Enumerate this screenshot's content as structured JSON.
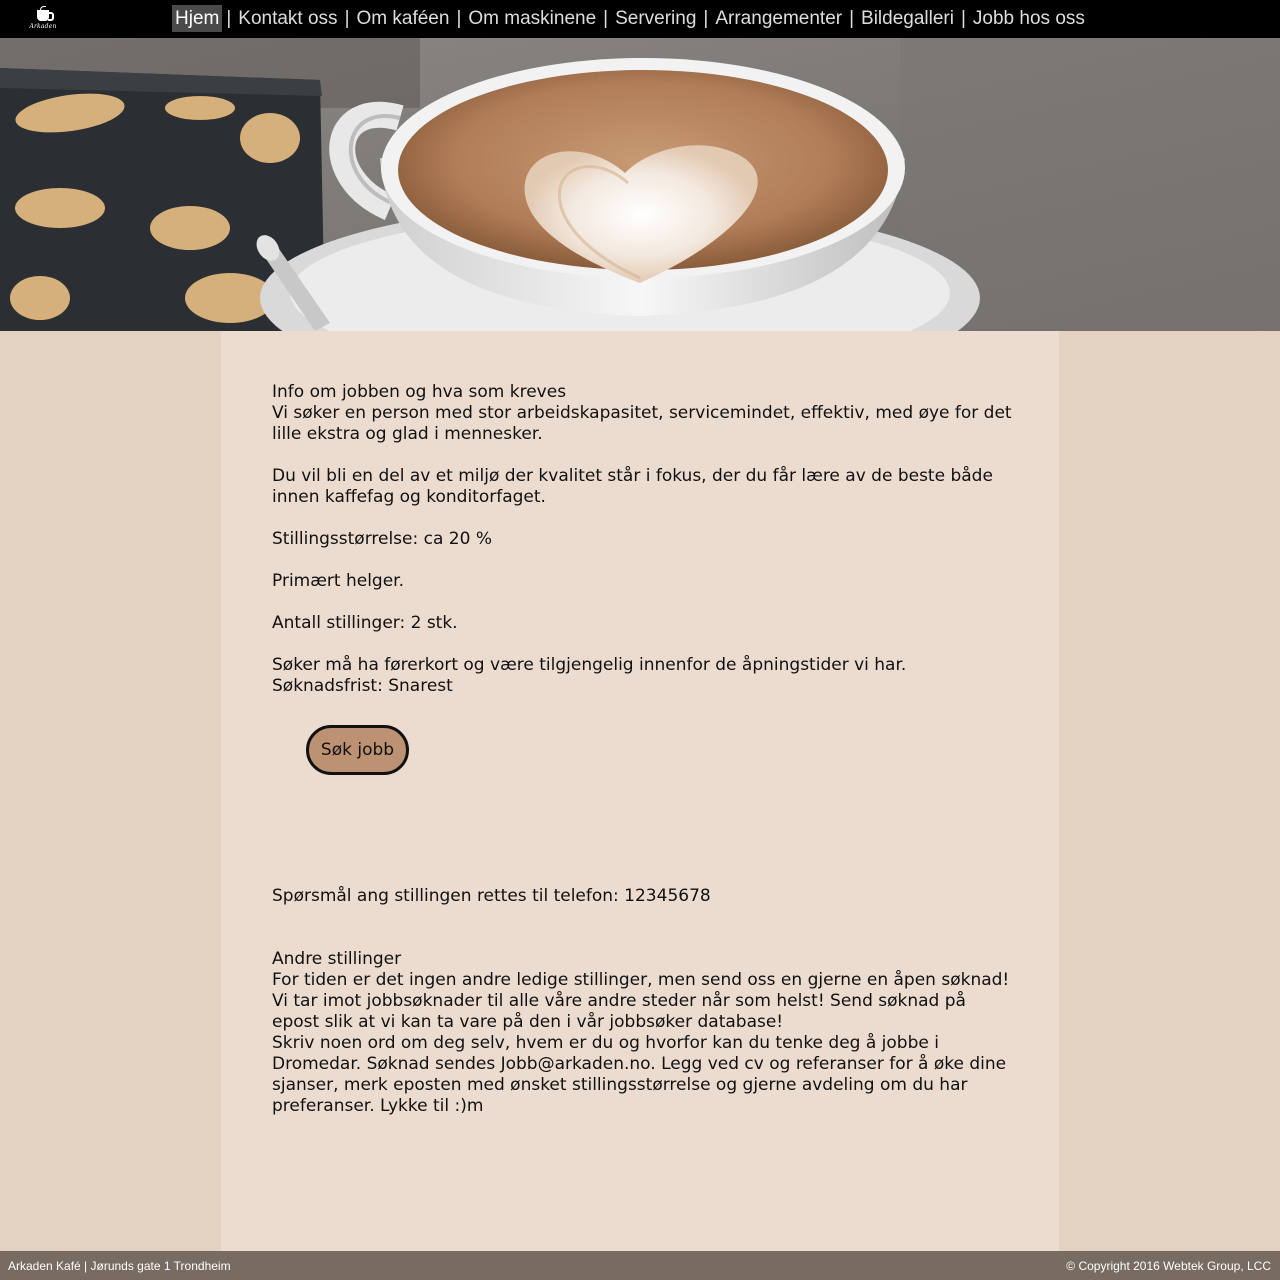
{
  "nav": {
    "logo_text": "Arkaden",
    "items": [
      {
        "label": "Hjem",
        "active": true
      },
      {
        "label": "Kontakt oss"
      },
      {
        "label": "Om kaféen"
      },
      {
        "label": "Om maskinene"
      },
      {
        "label": "Servering"
      },
      {
        "label": "Arrangementer"
      },
      {
        "label": "Bildegalleri"
      },
      {
        "label": "Jobb hos oss"
      }
    ],
    "separator": "|"
  },
  "content": {
    "job_heading": "Info om jobben og hva som kreves",
    "job_desc": "Vi søker en person med stor arbeidskapasitet, servicemindet, effektiv, med øye for det lille ekstra og glad i mennesker.",
    "environment": "Du vil bli en del av et miljø der kvalitet står i fokus, der du får lære av de beste både innen kaffefag og konditorfaget.",
    "position_size": "Stillingsstørrelse: ca 20 %",
    "primary": "Primært helger.",
    "count": "Antall stillinger: 2 stk.",
    "requirements": "Søker må ha førerkort og være tilgjengelig innenfor de åpningstider vi har.",
    "deadline": "Søknadsfrist: Snarest",
    "apply_button": "Søk jobb",
    "questions": "Spørsmål ang stillingen rettes til telefon: 12345678",
    "other_heading": "Andre stillinger",
    "other_text": "For tiden er det ingen andre ledige stillinger, men send oss en gjerne en åpen søknad! Vi tar imot jobbsøknader til alle våre andre steder når som helst! Send søknad på epost slik at vi kan ta vare på den i vår jobbsøker database!",
    "other_text2": "Skriv noen ord om deg selv, hvem er du og hvorfor kan du tenke deg å jobbe i Dromedar. Søknad sendes Jobb@arkaden.no. Legg ved cv og referanser for å øke dine sjanser, merk eposten med  ønsket stillingsstørrelse og gjerne avdeling om du har preferanser. Lykke til :)m"
  },
  "footer": {
    "left": "Arkaden Kafé | Jørunds gate 1 Trondheim",
    "right": "© Copyright 2016 Webtek Group, LCC"
  }
}
